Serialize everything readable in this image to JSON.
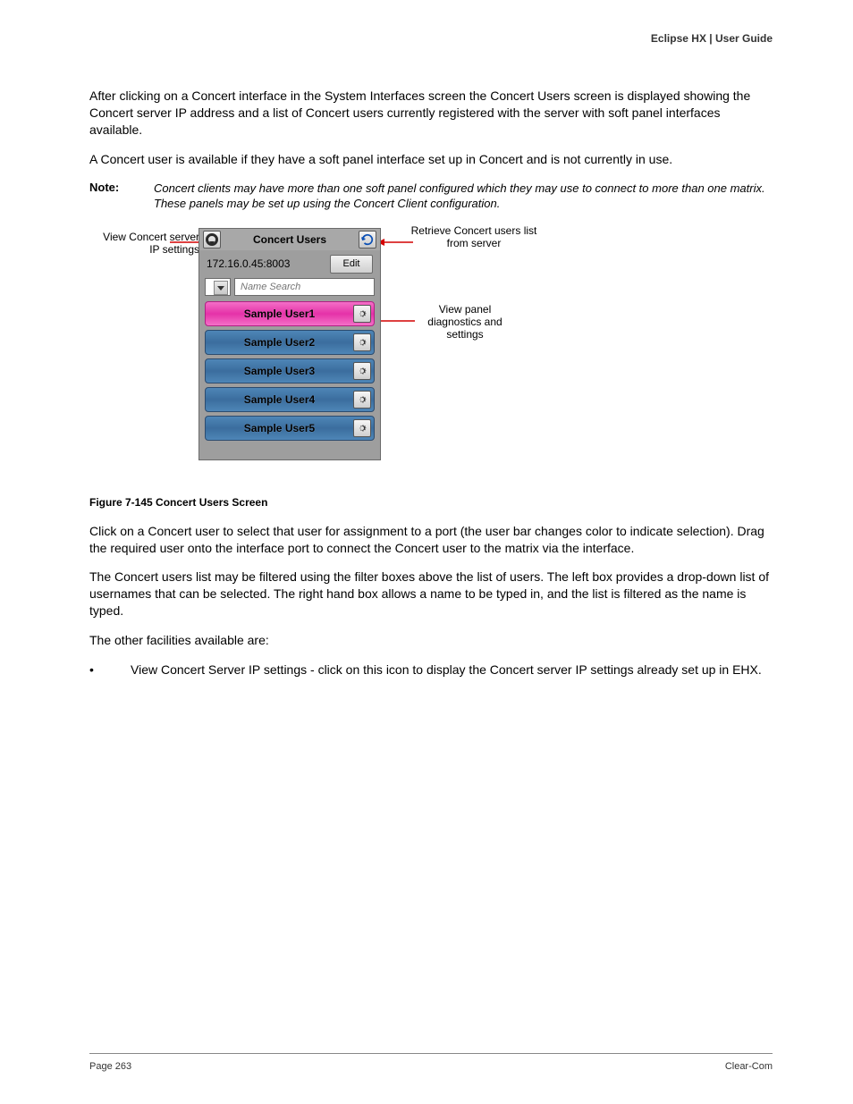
{
  "header": {
    "line1": "Eclipse HX | User Guide",
    "line2": ""
  },
  "paragraphs": {
    "p1": "After clicking on a Concert interface in the System Interfaces screen the Concert Users screen is displayed showing the Concert server IP address and a list of Concert users currently registered with the server with soft panel interfaces available.",
    "p2": "A Concert user is available if they have a soft panel interface set up in Concert and is not currently in use.",
    "p4": "Click on a Concert user to select that user for assignment to a port (the user bar changes color to indicate selection). Drag the required user onto the interface port to connect the Concert user to the matrix via the interface.",
    "p5": "The Concert users list may be filtered using the filter boxes above the list of users. The left box provides a drop-down list of usernames that can be selected. The right hand box allows a name to be typed in, and the list is filtered as the name is typed.",
    "p6": "The other facilities available are:",
    "li1": "View Concert Server IP settings - click on this icon to display the Concert server IP settings already set up in EHX."
  },
  "note": {
    "label": "Note:",
    "text": "Concert clients may have more than one soft panel configured which they may use to connect to more than one matrix. These panels may be set up using the Concert Client configuration."
  },
  "panel": {
    "title": "Concert Users",
    "address": "172.16.0.45:8003",
    "edit": "Edit",
    "search_placeholder": "Name Search",
    "users": [
      "Sample User1",
      "Sample User2",
      "Sample User3",
      "Sample User4",
      "Sample User5"
    ]
  },
  "callouts": {
    "left": "View Concert server IP settings",
    "r1": "Retrieve Concert users list from server",
    "r2": "View panel diagnostics and settings"
  },
  "caption": "Figure 7-145 Concert Users Screen",
  "footer": {
    "left": "Page 263",
    "right": "Clear-Com"
  }
}
